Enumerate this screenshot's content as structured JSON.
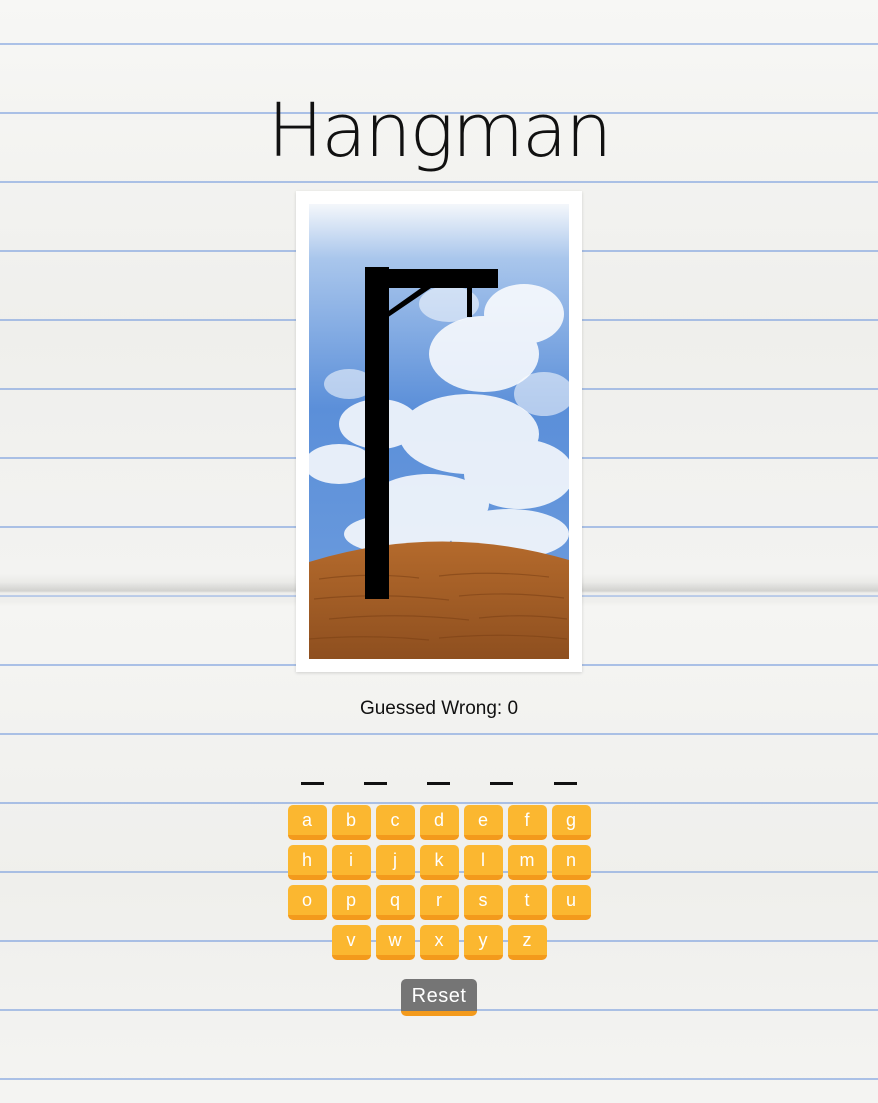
{
  "title": "Hangman",
  "status": {
    "label": "Guessed Wrong: ",
    "count": "0"
  },
  "word_blanks": 5,
  "keyboard": {
    "rows": [
      [
        "a",
        "b",
        "c",
        "d",
        "e",
        "f",
        "g"
      ],
      [
        "h",
        "i",
        "j",
        "k",
        "l",
        "m",
        "n"
      ],
      [
        "o",
        "p",
        "q",
        "r",
        "s",
        "t",
        "u"
      ],
      [
        "v",
        "w",
        "x",
        "y",
        "z"
      ]
    ]
  },
  "reset_label": "Reset",
  "colors": {
    "key": "#fbb730",
    "key_shadow": "#f39a1c",
    "reset": "#757575",
    "paper_line": "#6e96dc"
  }
}
